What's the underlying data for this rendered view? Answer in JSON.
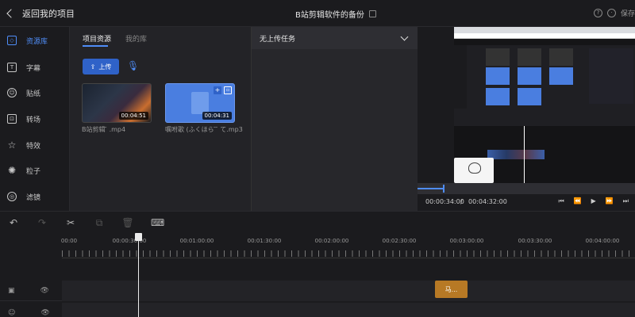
{
  "header": {
    "back_label": "返回我的项目",
    "project_title": "B站剪辑软件的备份",
    "save_label": "保存"
  },
  "sidebar": {
    "items": [
      {
        "label": "资源库",
        "icon": "cube-icon",
        "active": true
      },
      {
        "label": "字幕",
        "icon": "text-icon"
      },
      {
        "label": "贴纸",
        "icon": "sticker-icon"
      },
      {
        "label": "转场",
        "icon": "transition-icon"
      },
      {
        "label": "特效",
        "icon": "star-icon"
      },
      {
        "label": "粒子",
        "icon": "particle-icon"
      },
      {
        "label": "滤镜",
        "icon": "filter-icon"
      }
    ]
  },
  "assets": {
    "tabs": [
      "项目资源",
      "我的库"
    ],
    "active_tab": "项目资源",
    "upload_label": "上传",
    "items": [
      {
        "name": "B站剪辑  ̄ .mp4",
        "duration": "00:04:51",
        "type": "video"
      },
      {
        "name": "嘱咐歌 (ふくほら ̄  ̄ て.mp3",
        "duration": "00:04:31",
        "type": "audio"
      }
    ]
  },
  "tasks": {
    "title": "无上传任务"
  },
  "player": {
    "current_time": "00:00:34:00",
    "separator": "/",
    "total_time": "00:04:32:00",
    "progress": 0.12
  },
  "timeline": {
    "ticks": [
      "00:00",
      "00:00:30:00",
      "00:01:00:00",
      "00:01:30:00",
      "00:02:00:00",
      "00:02:30:00",
      "00:03:00:00",
      "00:03:30:00",
      "00:04:00:00"
    ],
    "clip_label": "马..."
  },
  "colors": {
    "accent": "#4f8df7",
    "clip": "#b77925",
    "background": "#1b1b1e"
  }
}
